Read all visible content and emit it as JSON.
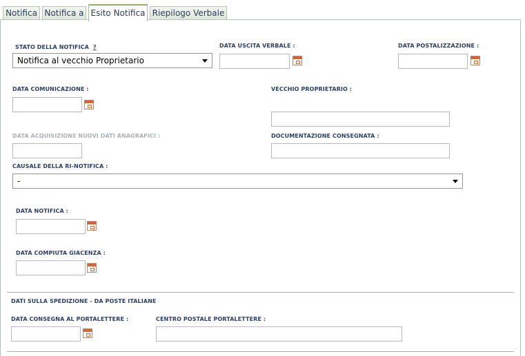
{
  "tabs": [
    {
      "label": "Notifica",
      "active": false
    },
    {
      "label": "Notifica a",
      "active": false
    },
    {
      "label": "Esito Notifica",
      "active": true
    },
    {
      "label": "Riepilogo Verbale",
      "active": false
    }
  ],
  "form": {
    "stato_notifica": {
      "label": "STATO DELLA NOTIFICA",
      "help": "?",
      "value": "Notifica al vecchio Proprietario"
    },
    "data_uscita_verbale": {
      "label": "DATA USCITA VERBALE :",
      "value": ""
    },
    "data_postalizzazione": {
      "label": "DATA POSTALIZZAZIONE :",
      "value": ""
    },
    "data_comunicazione": {
      "label": "DATA COMUNICAZIONE :",
      "value": ""
    },
    "vecchio_proprietario": {
      "label": "VECCHIO PROPRIETARIO :",
      "value": ""
    },
    "data_acquisizione": {
      "label": "DATA ACQUISIZIONE NUOVI DATI ANAGRAFICI :",
      "value": "",
      "disabled": true
    },
    "documentazione_consegnata": {
      "label": "DOCUMENTAZIONE CONSEGNATA :",
      "value": ""
    },
    "causale_rinotifica": {
      "label": "CAUSALE DELLA RI-NOTIFICA :",
      "value": "-"
    },
    "data_notifica": {
      "label": "DATA NOTIFICA :",
      "value": ""
    },
    "data_compiuta_giacenza": {
      "label": "DATA COMPIUTA GIACENZA :",
      "value": ""
    }
  },
  "spedizione": {
    "section_title": "DATI SULLA SPEDIZIONE - DA POSTE ITALIANE",
    "data_consegna_portalettere": {
      "label": "DATA CONSEGNA AL PORTALETTERE :",
      "value": ""
    },
    "centro_postale_portalettere": {
      "label": "CENTRO POSTALE PORTALETTERE :",
      "value": ""
    }
  },
  "colors": {
    "label": "#2b3f66",
    "disabled_label": "#aab0b8",
    "active_tab_accent": "#8fb25e",
    "calendar_icon": "#d8623a"
  }
}
